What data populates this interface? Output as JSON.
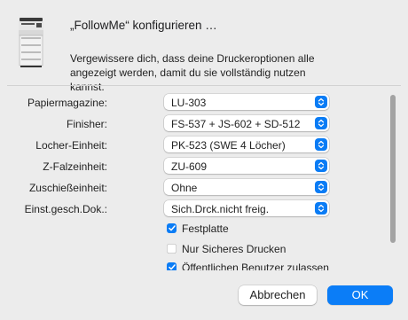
{
  "dialog": {
    "title": "„FollowMe“ konfigurieren …",
    "message": "Vergewissere dich, dass deine Druckeroptionen alle angezeigt werden, damit du sie vollständig nutzen kannst."
  },
  "options": [
    {
      "label": "Papiermagazine:",
      "value": "LU-303"
    },
    {
      "label": "Finisher:",
      "value": "FS-537 + JS-602 + SD-512"
    },
    {
      "label": "Locher-Einheit:",
      "value": "PK-523 (SWE 4 Löcher)"
    },
    {
      "label": "Z-Falzeinheit:",
      "value": "ZU-609"
    },
    {
      "label": "Zuschießeinheit:",
      "value": "Ohne"
    },
    {
      "label": "Einst.gesch.Dok.:",
      "value": "Sich.Drck.nicht freig."
    }
  ],
  "checkboxes": [
    {
      "label": "Festplatte",
      "checked": true
    },
    {
      "label": "Nur Sicheres Drucken",
      "checked": false
    },
    {
      "label": "Öffentlichen Benutzer zulassen",
      "checked": true
    }
  ],
  "buttons": {
    "cancel": "Abbrechen",
    "ok": "OK"
  },
  "colors": {
    "accent": "#0a7cf5",
    "background": "#ececec"
  }
}
